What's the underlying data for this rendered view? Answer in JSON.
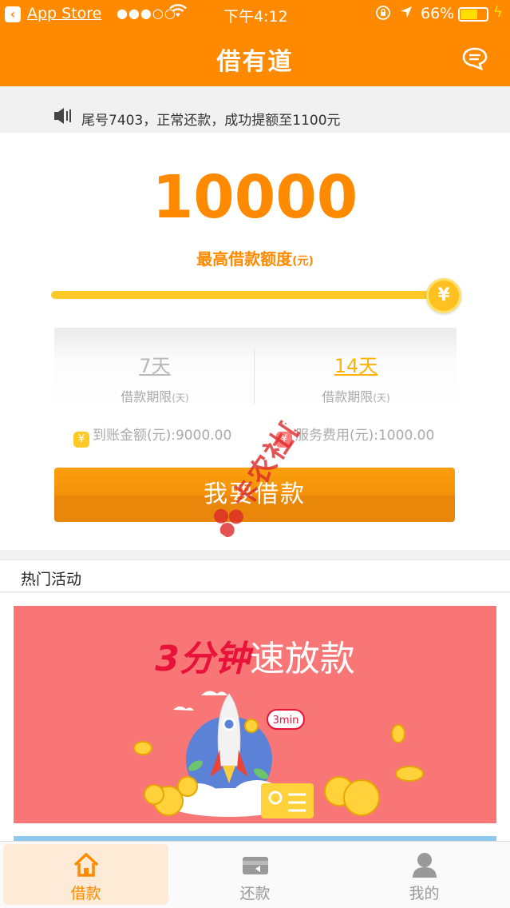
{
  "status_bar": {
    "carrier": "App Store",
    "signal": "●●●○○",
    "time": "下午4:12",
    "battery_percent": "66%",
    "battery_level": 0.66
  },
  "nav": {
    "title": "借有道",
    "message_icon": "chat-bubble-icon"
  },
  "notice": {
    "text": "尾号7403，正常还款，成功提额至1100元",
    "icon": "speaker-icon"
  },
  "loan": {
    "amount": "10000",
    "amount_label": "最高借款额度",
    "amount_unit": "(元)",
    "slider_value": 1.0,
    "slider_knob": "¥",
    "terms": [
      {
        "days": "7天",
        "label": "借款期限",
        "unit": "(天)",
        "selected": false
      },
      {
        "days": "14天",
        "label": "借款期限",
        "unit": "(天)",
        "selected": true
      }
    ],
    "received_amount": "到账金额(元):9000.00",
    "service_fee": "服务费用(元):1000.00",
    "borrow_button": "我要借款"
  },
  "watermark": "卡农社区",
  "hot": {
    "title": "热门活动",
    "banner": {
      "title_bold": "3分钟",
      "title_rest": "速放款",
      "badge": "3min"
    }
  },
  "tabs": [
    {
      "label": "借款",
      "icon": "home-icon",
      "active": true
    },
    {
      "label": "还款",
      "icon": "wallet-icon",
      "active": false
    },
    {
      "label": "我的",
      "icon": "person-icon",
      "active": false
    }
  ],
  "colors": {
    "brand": "#ff8a00",
    "banner": "#f97676",
    "slider": "#ffc928",
    "active_tab_bg": "#fdebd8"
  }
}
